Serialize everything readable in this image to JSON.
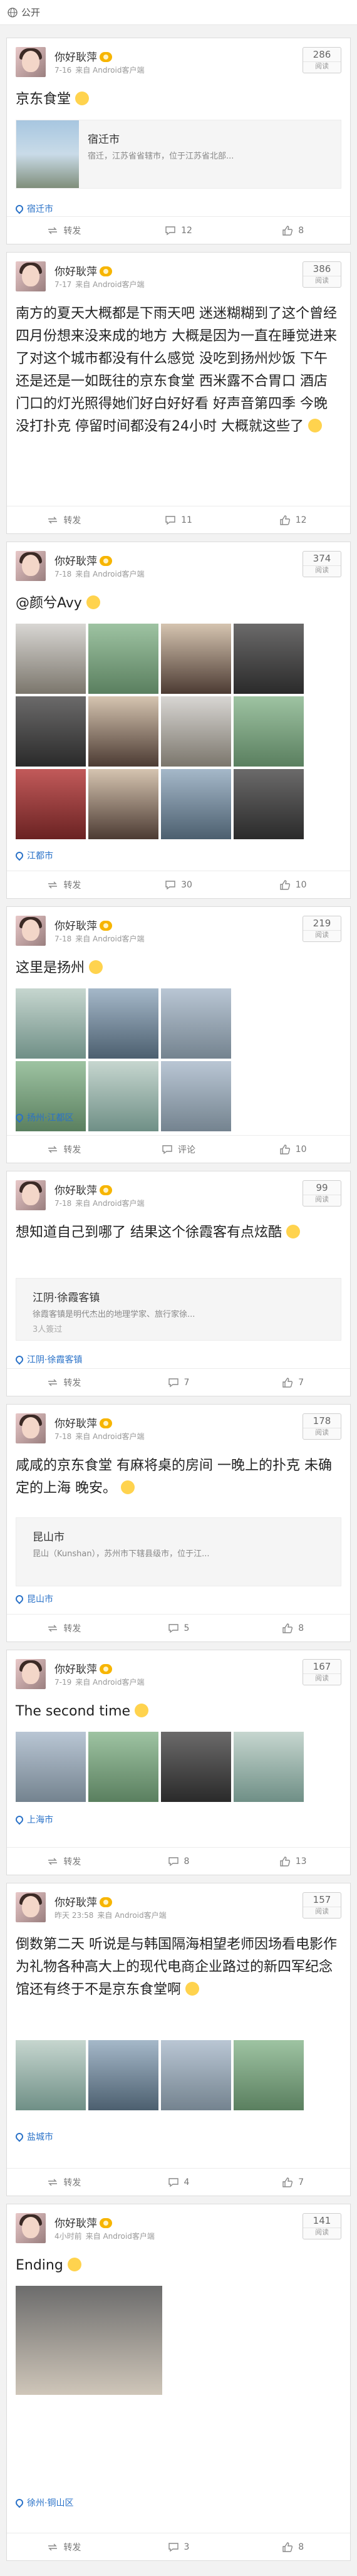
{
  "header": {
    "title": "公开",
    "icon": "globe-icon"
  },
  "actions": {
    "repost": "转发"
  },
  "posts": [
    {
      "user": "你好耿萍",
      "time": "7-16",
      "source": "来自 Android客户端",
      "reads": "286",
      "reads_label": "阅读",
      "text": "京东食堂",
      "loc_title": "宿迁市",
      "loc_desc": "宿迁，江苏省省辖市，位于江苏省北部...",
      "place": "宿迁市",
      "comments": "12",
      "likes": "8"
    },
    {
      "user": "你好耿萍",
      "time": "7-17",
      "source": "来自 Android客户端",
      "reads": "386",
      "reads_label": "阅读",
      "text": "南方的夏天大概都是下雨天吧 迷迷糊糊到了这个曾经四月份想来没来成的地方 大概是因为一直在睡觉进来了对这个城市都没有什么感觉 没吃到扬州炒饭 下午还是还是一如既往的京东食堂 西米露不合胃口 酒店门口的灯光照得她们好白好好看 好声音第四季 今晚没打扑克 停留时间都没有24小时 大概就这些了",
      "comments": "11",
      "likes": "12"
    },
    {
      "user": "你好耿萍",
      "time": "7-18",
      "source": "来自 Android客户端",
      "reads": "374",
      "reads_label": "阅读",
      "text": "@颜兮Avy",
      "place": "江都市",
      "comments": "30",
      "likes": "10"
    },
    {
      "user": "你好耿萍",
      "time": "7-18",
      "source": "来自 Android客户端",
      "reads": "219",
      "reads_label": "阅读",
      "text": "这里是扬州",
      "place": "扬州·江都区",
      "comment_label": "评论",
      "likes": "10"
    },
    {
      "user": "你好耿萍",
      "time": "7-18",
      "source": "来自 Android客户端",
      "reads": "99",
      "reads_label": "阅读",
      "text": "想知道自己到哪了 结果这个徐霞客有点炫酷",
      "loc_title": "江阴·徐霞客镇",
      "loc_desc": "徐霞客镇是明代杰出的地理学家、旅行家徐...",
      "loc_sub": "3人簽过",
      "place": "江阴·徐霞客镇",
      "comments": "7",
      "likes": "7"
    },
    {
      "user": "你好耿萍",
      "time": "7-18",
      "source": "来自 Android客户端",
      "reads": "178",
      "reads_label": "阅读",
      "text": "咸咸的京东食堂 有麻将桌的房间 一晚上的扑克 未确定的上海 晚安。",
      "loc_title": "昆山市",
      "loc_desc": "昆山（Kunshan），苏州市下辖县级市，位于江...",
      "place": "昆山市",
      "comments": "5",
      "likes": "8"
    },
    {
      "user": "你好耿萍",
      "time": "7-19",
      "source": "来自 Android客户端",
      "reads": "167",
      "reads_label": "阅读",
      "text": "The second time",
      "place": "上海市",
      "comments": "8",
      "likes": "13"
    },
    {
      "user": "你好耿萍",
      "time": "昨天 23:58",
      "source": "来自 Android客户端",
      "reads": "157",
      "reads_label": "阅读",
      "text": "倒数第二天 听说是与韩国隔海相望老师因场看电影作为礼物各种高大上的现代电商企业路过的新四军纪念馆还有终于不是京东食堂啊",
      "place": "盐城市",
      "comments": "4",
      "likes": "7"
    },
    {
      "user": "你好耿萍",
      "time": "4小时前",
      "source": "来自 Android客户端",
      "reads": "141",
      "reads_label": "阅读",
      "text": "Ending",
      "place": "徐州·铜山区",
      "comments": "3",
      "likes": "8"
    }
  ]
}
